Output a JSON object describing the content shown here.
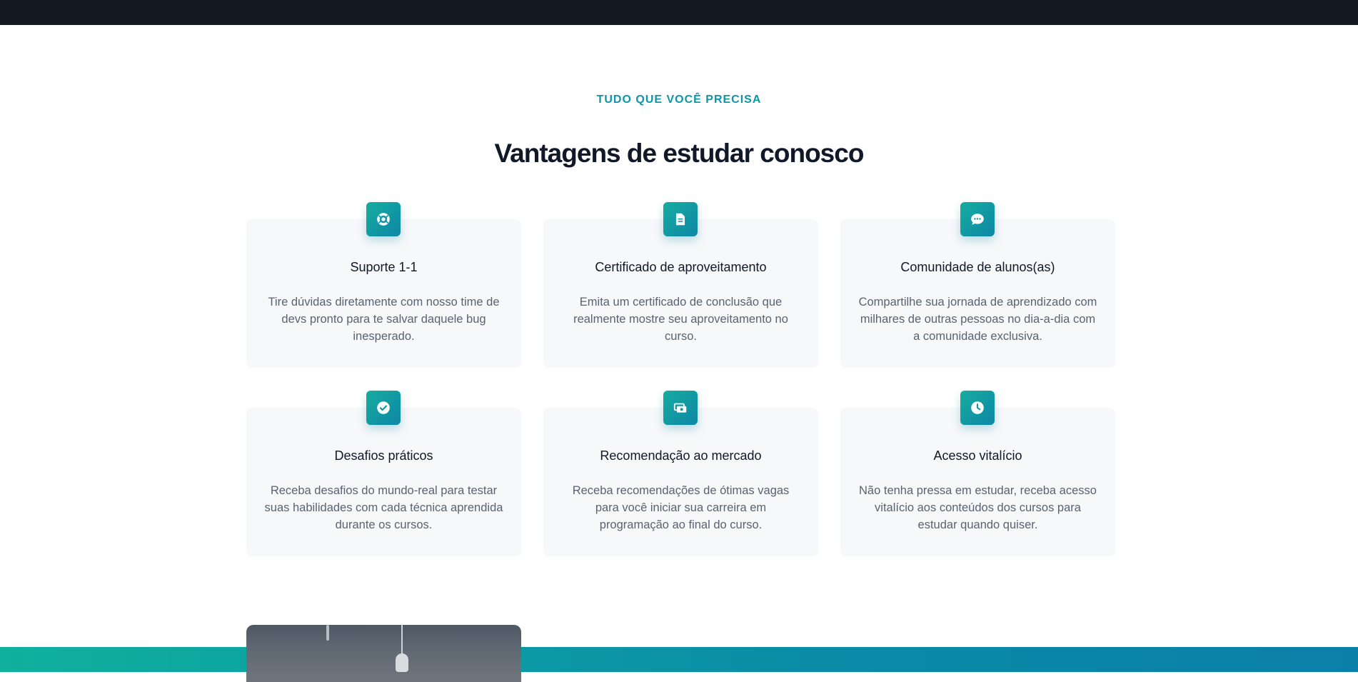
{
  "section": {
    "eyebrow": "TUDO QUE VOCÊ PRECISA",
    "title": "Vantagens de estudar conosco"
  },
  "features": [
    {
      "icon": "lifebuoy-icon",
      "title": "Suporte 1-1",
      "text": "Tire dúvidas diretamente com nosso time de devs pronto para te salvar daquele bug inesperado."
    },
    {
      "icon": "document-icon",
      "title": "Certificado de aproveitamento",
      "text": "Emita um certificado de conclusão que realmente mostre seu aproveitamento no curso."
    },
    {
      "icon": "chat-bubble-icon",
      "title": "Comunidade de alunos(as)",
      "text": "Compartilhe sua jornada de aprendizado com milhares de outras pessoas no dia-a-dia com a comunidade exclusiva."
    },
    {
      "icon": "check-circle-icon",
      "title": "Desafios práticos",
      "text": "Receba desafios do mundo-real para testar suas habilidades com cada técnica aprendida durante os cursos."
    },
    {
      "icon": "cash-icon",
      "title": "Recomendação ao mercado",
      "text": "Receba recomendações de ótimas vagas para você iniciar sua carreira em programação ao final do curso."
    },
    {
      "icon": "clock-icon",
      "title": "Acesso vitalício",
      "text": "Não tenha pressa em estudar, receba acesso vitalício aos conteúdos dos cursos para estudar quando quiser."
    }
  ],
  "colors": {
    "accent": "#0e96a8",
    "gradient_start": "#15ad9f",
    "gradient_end": "#0e86a6",
    "topbar": "#131823",
    "card_bg": "#f6f8fa"
  }
}
